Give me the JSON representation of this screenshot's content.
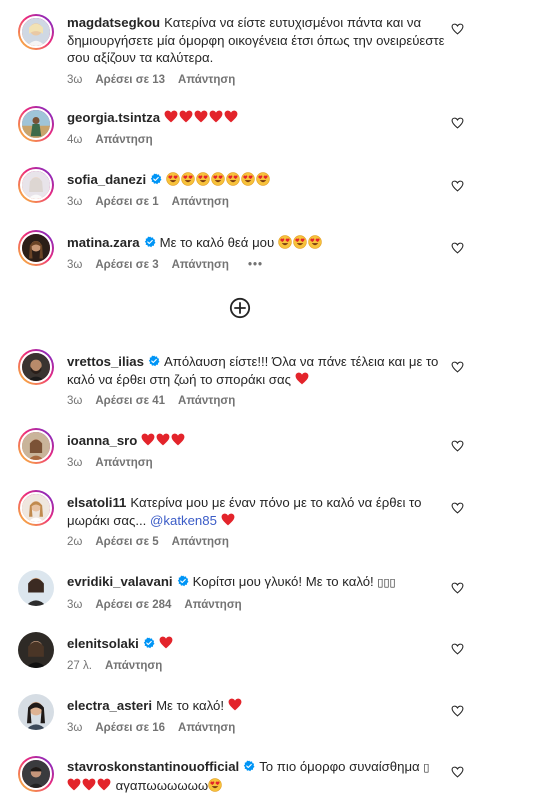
{
  "comments": [
    {
      "username": "magdatsegkou",
      "verified": false,
      "text": "Κατερίνα να είστε ευτυχισμένοι πάντα και να δημιουργήσετε μία όμορφη οικογένεια έτσι όπως την ονειρεύεστε σου αξίζουν τα καλύτερα.",
      "time": "3ω",
      "likes": "Αρέσει σε 13",
      "reply": "Απάντηση"
    },
    {
      "username": "georgia.tsintza",
      "verified": false,
      "text": "",
      "time": "4ω",
      "reply": "Απάντηση"
    },
    {
      "username": "sofia_danezi",
      "verified": true,
      "text": "",
      "time": "3ω",
      "likes": "Αρέσει σε 1",
      "reply": "Απάντηση"
    },
    {
      "username": "matina.zara",
      "verified": true,
      "text": "Με το καλό θεά μου",
      "time": "3ω",
      "likes": "Αρέσει σε 3",
      "reply": "Απάντηση",
      "more": "•••"
    },
    {
      "username": "vrettos_ilias",
      "verified": true,
      "text": "Απόλαυση είστε!!! Όλα να πάνε τέλεια και με το καλό να έρθει στη ζωή το σποράκι σας",
      "time": "3ω",
      "likes": "Αρέσει σε 41",
      "reply": "Απάντηση"
    },
    {
      "username": "ioanna_sro",
      "verified": false,
      "text": "",
      "time": "3ω",
      "reply": "Απάντηση"
    },
    {
      "username": "elsatoli11",
      "verified": false,
      "text": "Κατερίνα μου με έναν πόνο με το καλό να έρθει το μωράκι σας...",
      "mention": "@katken85",
      "time": "2ω",
      "likes": "Αρέσει σε 5",
      "reply": "Απάντηση"
    },
    {
      "username": "evridiki_valavani",
      "verified": true,
      "text": "Κορίτσι μου γλυκό! Με το καλό!",
      "boxes": "▯▯▯",
      "time": "3ω",
      "likes": "Αρέσει σε 284",
      "reply": "Απάντηση"
    },
    {
      "username": "elenitsolaki",
      "verified": true,
      "text": "",
      "time": "27 λ.",
      "reply": "Απάντηση"
    },
    {
      "username": "electra_asteri",
      "verified": false,
      "text": "Με το καλό!",
      "time": "3ω",
      "likes": "Αρέσει σε 16",
      "reply": "Απάντηση"
    },
    {
      "username": "stavroskonstantinouofficial",
      "verified": true,
      "text": "Το πιο όμορφο συναίσθημα",
      "box": "▯",
      "text2": "αγαπωωωωωω",
      "time": "",
      "reply": ""
    }
  ],
  "icons": {
    "like": "heart-outline-icon",
    "load_more": "plus-circle-icon",
    "verified": "verified-badge-icon",
    "heart_emoji": "red-heart-emoji",
    "face_emoji": "heart-eyes-emoji"
  },
  "colors": {
    "text": "#262626",
    "meta": "#737373",
    "mention": "#3b5cc7",
    "verified": "#0095f6",
    "heart": "#e3242b"
  }
}
